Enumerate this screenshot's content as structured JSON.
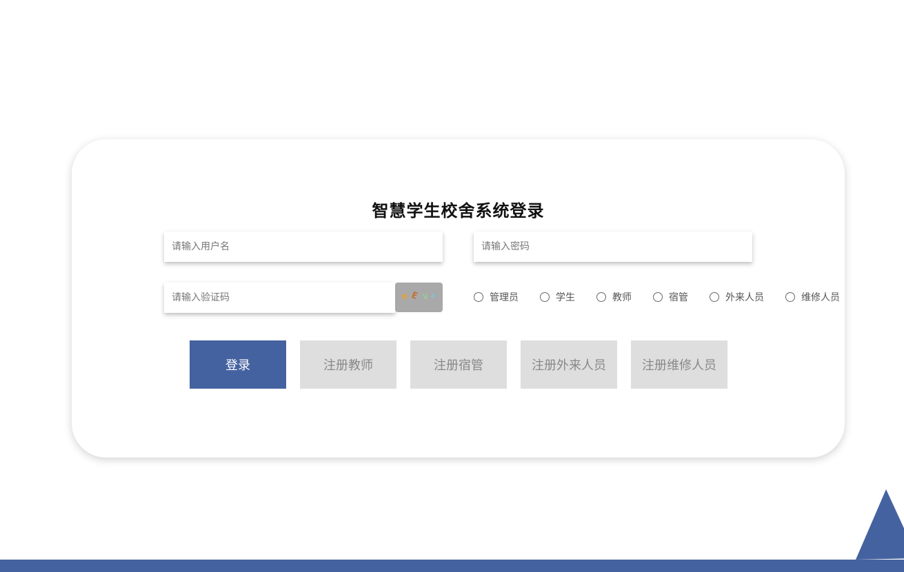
{
  "login": {
    "title": "智慧学生校舍系统登录",
    "username_placeholder": "请输入用户名",
    "password_placeholder": "请输入密码",
    "captcha_placeholder": "请输入验证码",
    "captcha": {
      "chars": [
        "m",
        "E",
        "v",
        "x"
      ],
      "colors": [
        "#e6a23c",
        "#c56a2a",
        "#8fd18f",
        "#7fc8d6"
      ]
    },
    "roles": [
      "管理员",
      "学生",
      "教师",
      "宿管",
      "外来人员",
      "维修人员"
    ],
    "login_button": "登录",
    "register_buttons": [
      "注册教师",
      "注册宿管",
      "注册外来人员",
      "注册维修人员"
    ]
  },
  "theme": {
    "accent": "#4562a0",
    "secondary_button": "#dedede"
  }
}
